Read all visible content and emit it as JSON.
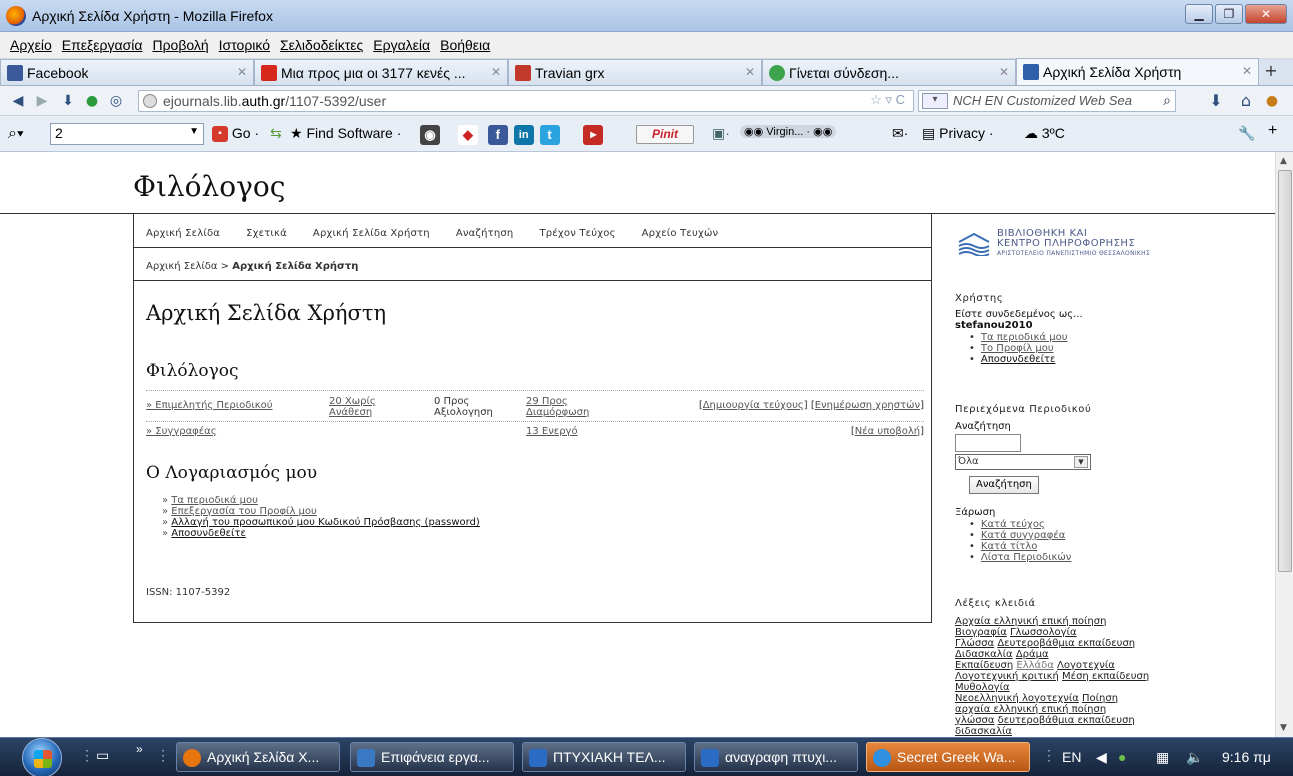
{
  "window": {
    "title": "Αρχική Σελίδα Χρήστη - Mozilla Firefox",
    "min": "▁",
    "max": "❐",
    "close": "✕"
  },
  "menu": [
    "Αρχείο",
    "Επεξεργασία",
    "Προβολή",
    "Ιστορικό",
    "Σελιδοδείκτες",
    "Εργαλεία",
    "Βοήθεια"
  ],
  "tabs": [
    {
      "label": "Facebook",
      "color": "#3b5998"
    },
    {
      "label": "Μια προς μια οι 3177 κενές ...",
      "color": "#d6281c"
    },
    {
      "label": "Travian grx",
      "color": "#c0392b"
    },
    {
      "label": "Γίνεται σύνδεση...",
      "color": "#3fa34d"
    },
    {
      "label": "Αρχική Σελίδα Χρήστη",
      "color": "#2f5fa8"
    }
  ],
  "nav": {
    "url_prefix": "ejournals.lib.",
    "url_domain": "auth.gr",
    "url_suffix": "/1107-5392/user",
    "search_placeholder": "NCH EN Customized Web Sea"
  },
  "toolbar": {
    "search_value": "2",
    "go": "Go",
    "find_software": "Find Software",
    "pinit": "Pinit",
    "virgin": "Virgin...",
    "privacy": "Privacy",
    "temp": "3ºC"
  },
  "site": {
    "title": "Φιλόλογος",
    "nav": [
      "Αρχική Σελίδα",
      "Σχετικά",
      "Αρχική Σελίδα Χρήστη",
      "Αναζήτηση",
      "Τρέχον Τεύχος",
      "Αρχείο Τευχών"
    ],
    "breadcrumb_home": "Αρχική Σελίδα",
    "breadcrumb_sep": " > ",
    "breadcrumb_current": "Αρχική Σελίδα Χρήστη",
    "heading": "Αρχική Σελίδα Χρήστη",
    "journal_heading": "Φιλόλογος",
    "roles": {
      "editor": {
        "name": "» Επιμελητής Περιοδικού",
        "c1": "20 Χωρίς Ανάθεση",
        "c2": "0 Προς Αξιολογηση",
        "c3": "29 Προς Διαμόρφωση",
        "action1": "Δημιουργία τεύχους",
        "action2": "Ενημέρωση χρηστών"
      },
      "author": {
        "name": "» Συγγραφέας",
        "c3": "13 Ενεργό",
        "action1": "Νέα υποβολή"
      }
    },
    "account_heading": "Ο Λογαριασμός μου",
    "account_links": [
      "Τα περιοδικά μου",
      "Επεξεργασία του Προφίλ μου",
      "Αλλαγή του προσωπικού μου Κωδικού Πρόσβασης (password)",
      "Αποσυνδεθείτε"
    ],
    "issn": "ISSN: 1107-5392"
  },
  "sidebar": {
    "logo_line1": "ΒΙΒΛΙΟΘΗΚΗ ΚΑΙ",
    "logo_line2": "ΚΕΝΤΡΟ ΠΛΗΡΟΦΟΡΗΣΗΣ",
    "logo_line3": "ΑΡΙΣΤΟΤΕΛΕΙΟ ΠΑΝΕΠΙΣΤΗΜΙΟ ΘΕΣΣΑΛΟΝΙΚΗΣ",
    "user_heading": "Χρήστης",
    "logged_in_as": "Είστε συνδεδεμένος ως...",
    "username": "stefanou2010",
    "user_links": [
      "Τα περιοδικά μου",
      "Το Προφίλ μου",
      "Αποσυνδεθείτε"
    ],
    "content_heading": "Περιεχόμενα Περιοδικού",
    "search_label": "Αναζήτηση",
    "search_scope": "Όλα",
    "search_button": "Αναζήτηση",
    "browse_heading": "Ξάρωση",
    "browse_links": [
      "Κατά τεύχος",
      "Κατά συγγραφέα",
      "Κατά τίτλο",
      "Λίστα Περιοδικών"
    ],
    "keywords_heading": "Λέξεις κλειδιά",
    "keywords": [
      {
        "t": "Αρχαία ελληνική επική ποίηση",
        "light": false
      },
      {
        "t": "Βιογραφία",
        "light": false
      },
      {
        "t": "Γλωσσολογία",
        "light": false
      },
      {
        "t": "Γλώσσα",
        "light": false
      },
      {
        "t": "Δευτεροβάθμια εκπαίδευση",
        "light": false
      },
      {
        "t": "Διδασκαλία",
        "light": false
      },
      {
        "t": "Δράμα",
        "light": false
      },
      {
        "t": "Εκπαίδευση",
        "light": false
      },
      {
        "t": "Ελλάδα",
        "light": true
      },
      {
        "t": "Λογοτεχνία",
        "light": false
      },
      {
        "t": "Λογοτεχνική κριτική",
        "light": false
      },
      {
        "t": "Μέση εκπαίδευση",
        "light": false
      },
      {
        "t": "Μυθολογία",
        "light": false
      },
      {
        "t": "Νεοελληνική λογοτεχνία",
        "light": false
      },
      {
        "t": "Ποίηση",
        "light": false
      },
      {
        "t": "αρχαία ελληνική επική ποίηση",
        "light": false
      },
      {
        "t": "γλώσσα",
        "light": false
      },
      {
        "t": "δευτεροβάθμια εκπαίδευση",
        "light": false
      },
      {
        "t": "διδασκαλία",
        "light": false
      }
    ]
  },
  "taskbar": {
    "items": [
      {
        "label": "Αρχική Σελίδα Χ...",
        "color": "#e8750f",
        "active": false
      },
      {
        "label": "Επιφάνεια εργα...",
        "color": "#3a78c4",
        "active": false
      },
      {
        "label": "ΠΤΥΧΙΑΚΗ ΤΕΛ...",
        "color": "#2b6cc4",
        "active": false
      },
      {
        "label": "αναγραφη πτυχι...",
        "color": "#2b6cc4",
        "active": false
      },
      {
        "label": "Secret Greek Wa...",
        "color": "#2f8fe0",
        "active": true
      }
    ],
    "lang": "EN",
    "time": "9:16 πμ"
  }
}
